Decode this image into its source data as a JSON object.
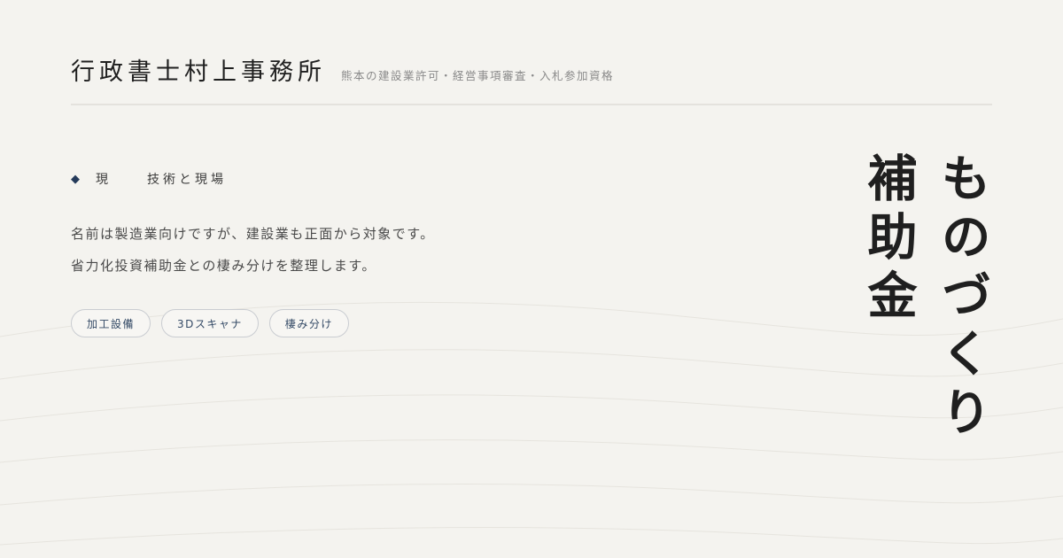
{
  "header": {
    "office_name": "行政書士村上事務所",
    "tagline": "熊本の建設業許可・経営事項審査・入札参加資格"
  },
  "category": {
    "marker": "◆",
    "part1": "現",
    "part2": "技術と現場"
  },
  "description": [
    "名前は製造業向けですが、建設業も正面から対象です。",
    "省力化投資補助金との棲み分けを整理します。"
  ],
  "tags": [
    "加工設備",
    "3Dスキャナ",
    "棲み分け"
  ],
  "title": {
    "line1": "ものづくり",
    "line2": "補助金"
  }
}
